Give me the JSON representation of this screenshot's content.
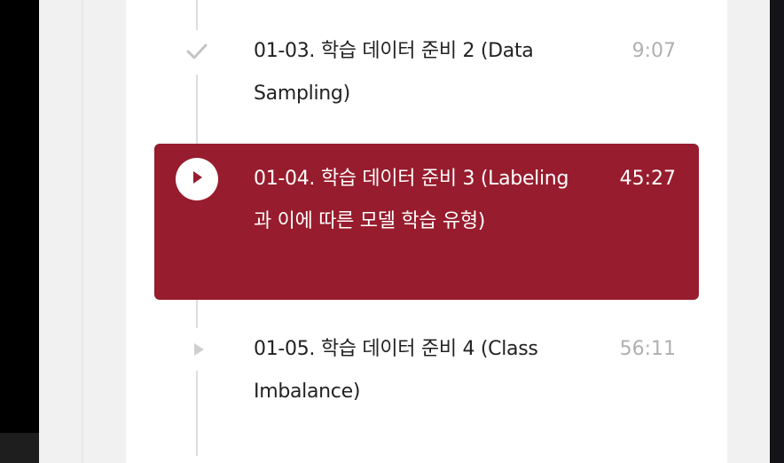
{
  "lessons": [
    {
      "title": "01-03. 학습 데이터 준비 2 (Data Sampling)",
      "time": "9:07",
      "status": "check-icon"
    },
    {
      "title": "01-04. 학습 데이터 준비 3 (Labeling과 이에 따른 모델 학습 유형)",
      "time": "45:27",
      "status": "play-icon"
    },
    {
      "title": "01-05. 학습 데이터 준비 4 (Class Imbalance)",
      "time": "56:11",
      "status": "play-small-icon"
    }
  ],
  "colors": {
    "active_bg": "#971c2d",
    "muted_time": "#b0b0b0",
    "timeline": "#dddddd"
  }
}
